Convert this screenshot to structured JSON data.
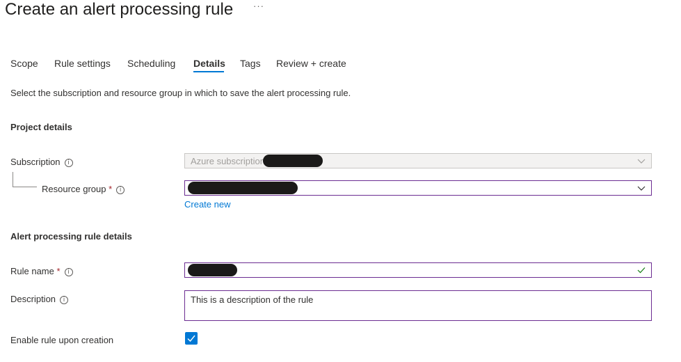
{
  "header": {
    "title": "Create an alert processing rule",
    "more_label": "···"
  },
  "tabs": [
    {
      "label": "Scope"
    },
    {
      "label": "Rule settings"
    },
    {
      "label": "Scheduling"
    },
    {
      "label": "Details",
      "active": true
    },
    {
      "label": "Tags"
    },
    {
      "label": "Review + create"
    }
  ],
  "intro": "Select the subscription and resource group in which to save the alert processing rule.",
  "project_details": {
    "heading": "Project details",
    "subscription": {
      "label": "Subscription",
      "value": "Azure subscription",
      "disabled": true
    },
    "resource_group": {
      "label": "Resource group",
      "required_marker": "*",
      "create_new_label": "Create new"
    }
  },
  "rule_details": {
    "heading": "Alert processing rule details",
    "rule_name": {
      "label": "Rule name",
      "required_marker": "*"
    },
    "description": {
      "label": "Description",
      "value": "This is a description of the rule"
    },
    "enable": {
      "label": "Enable rule upon creation",
      "checked": true
    }
  },
  "colors": {
    "accent": "#0078d4",
    "focus_border": "#6b2c91",
    "required": "#a4262c",
    "valid_check": "#107c10"
  },
  "icons": [
    "more-icon",
    "info-icon",
    "chevron-down-icon",
    "checkmark-icon"
  ]
}
